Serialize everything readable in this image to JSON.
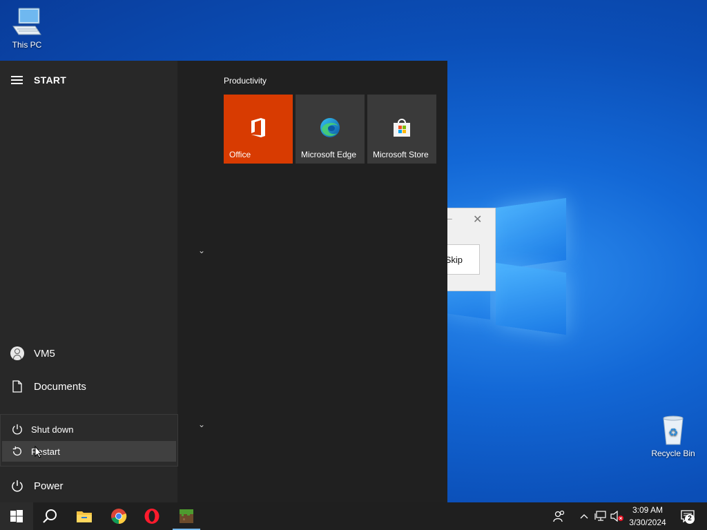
{
  "desktop": {
    "icons": [
      {
        "label": "This PC",
        "icon": "computer-icon"
      },
      {
        "label": "Recycle Bin",
        "icon": "recycle-bin-icon"
      }
    ]
  },
  "background_dialog": {
    "skip_label": "Skip"
  },
  "start_menu": {
    "title": "START",
    "user": "VM5",
    "documents": "Documents",
    "power": "Power",
    "power_flyout": {
      "shutdown": "Shut down",
      "restart": "Restart"
    },
    "group": {
      "title": "Productivity",
      "tiles": [
        {
          "label": "Office",
          "color": "#d83b01",
          "icon": "office-icon"
        },
        {
          "label": "Microsoft Edge",
          "color": "#3a3a3a",
          "icon": "edge-icon"
        },
        {
          "label": "Microsoft Store",
          "color": "#3a3a3a",
          "icon": "store-icon"
        }
      ]
    }
  },
  "taskbar": {
    "apps": [
      "start-icon",
      "search-icon",
      "file-explorer-icon",
      "chrome-icon",
      "opera-icon",
      "minecraft-icon"
    ],
    "clock": {
      "time": "3:09 AM",
      "date": "3/30/2024"
    },
    "notification_count": "2"
  },
  "colors": {
    "accent": "#76b9ed",
    "office_tile": "#d83b01",
    "start_bg": "#202020",
    "taskbar_bg": "#1f1f1f"
  }
}
